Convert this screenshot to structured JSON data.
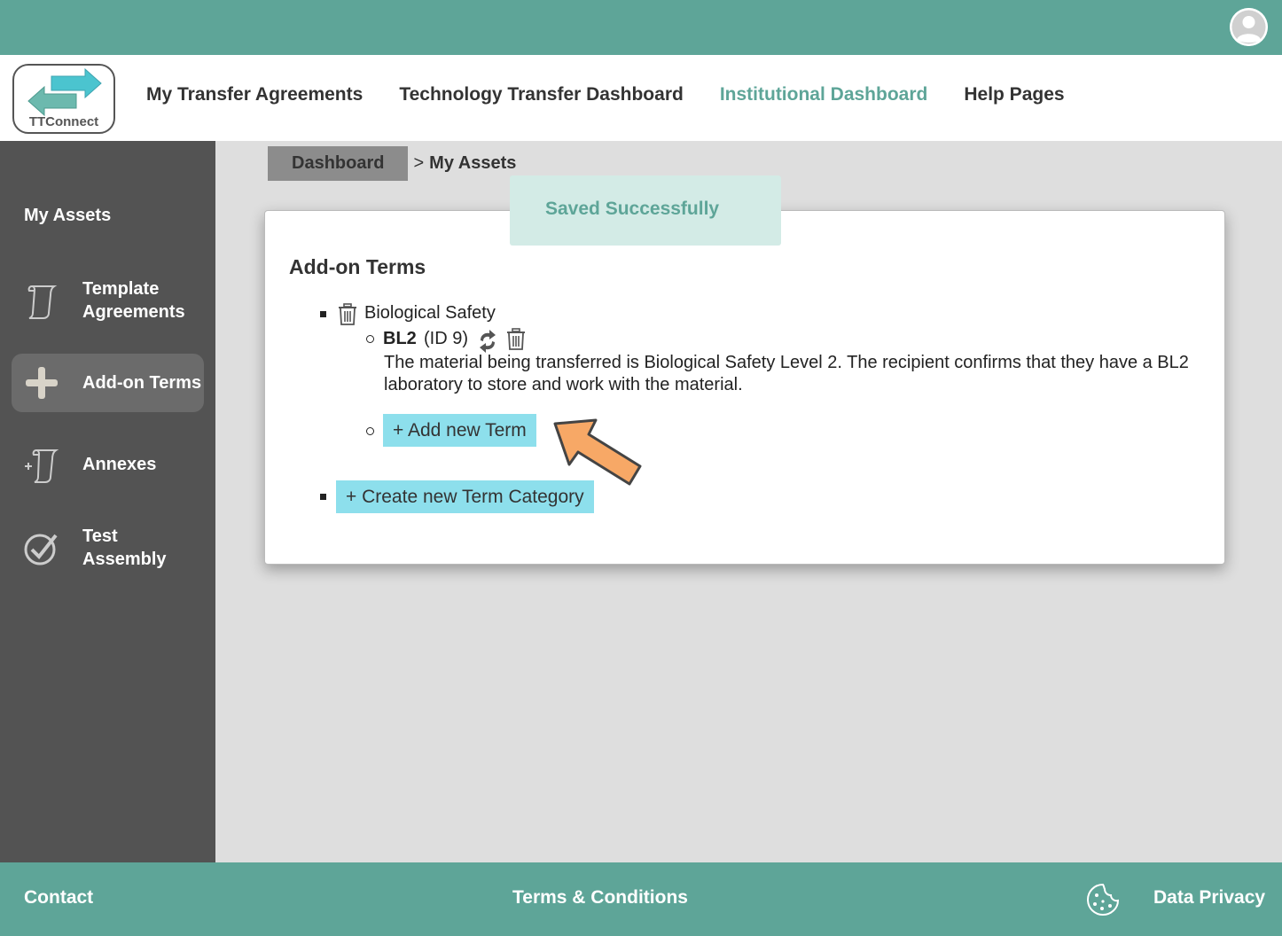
{
  "header": {
    "logo_text": "TTConnect",
    "nav": [
      {
        "label": "My Transfer Agreements",
        "active": false
      },
      {
        "label": "Technology Transfer Dashboard",
        "active": false
      },
      {
        "label": "Institutional Dashboard",
        "active": true
      },
      {
        "label": "Help Pages",
        "active": false
      }
    ]
  },
  "sidebar": {
    "title": "My Assets",
    "items": [
      {
        "label": "Template Agreements",
        "icon": "scroll-icon"
      },
      {
        "label": "Add-on Terms",
        "icon": "plus-icon",
        "active": true
      },
      {
        "label": "Annexes",
        "icon": "scroll-plus-icon"
      },
      {
        "label": "Test Assembly",
        "icon": "check-circle-icon"
      }
    ]
  },
  "breadcrumb": {
    "dashboard": "Dashboard",
    "separator": ">",
    "current": "My Assets"
  },
  "toast": {
    "message": "Saved Successfully"
  },
  "main": {
    "title": "Add-on Terms",
    "category": "Biological Safety",
    "term": {
      "name": "BL2",
      "id_text": "(ID 9)",
      "description": "The material being transferred is Biological Safety Level 2. The recipient confirms that they have a BL2 laboratory to store and work with the material."
    },
    "add_term_label": "+ Add new Term",
    "create_category_label": "+ Create new Term Category"
  },
  "footer": {
    "contact": "Contact",
    "terms": "Terms & Conditions",
    "privacy": "Data Privacy"
  },
  "colors": {
    "brand": "#5ea598",
    "sidebar": "#535353",
    "button": "#8ddfec",
    "arrow": "#f7a866"
  }
}
